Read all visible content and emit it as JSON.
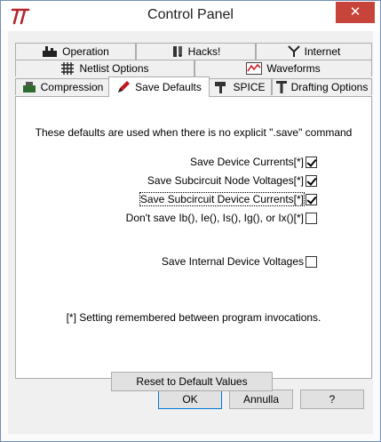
{
  "window": {
    "title": "Control Panel",
    "close_label": "✕"
  },
  "tabs": {
    "row1": [
      "Operation",
      "Hacks!",
      "Internet"
    ],
    "row2": [
      "Netlist Options",
      "Waveforms"
    ],
    "row3": [
      "Compression",
      "Save Defaults",
      "SPICE",
      "Drafting Options"
    ],
    "active": "Save Defaults"
  },
  "panel": {
    "intro": "These defaults are used when there is no explicit \".save\" command",
    "options": [
      {
        "label": "Save Device Currents[*]",
        "checked": true
      },
      {
        "label": "Save Subcircuit Node Voltages[*]",
        "checked": true
      },
      {
        "label": "Save Subcircuit Device Currents[*]",
        "checked": true
      },
      {
        "label": "Don't save Ib(), Ie(), Is(), Ig(), or Ix()[*]",
        "checked": false
      },
      {
        "label": "Save Internal Device Voltages",
        "checked": false
      }
    ],
    "footnote": "[*] Setting remembered between program invocations.",
    "reset_label": "Reset to Default Values"
  },
  "buttons": {
    "ok": "OK",
    "cancel": "Annulla",
    "help": "?"
  }
}
